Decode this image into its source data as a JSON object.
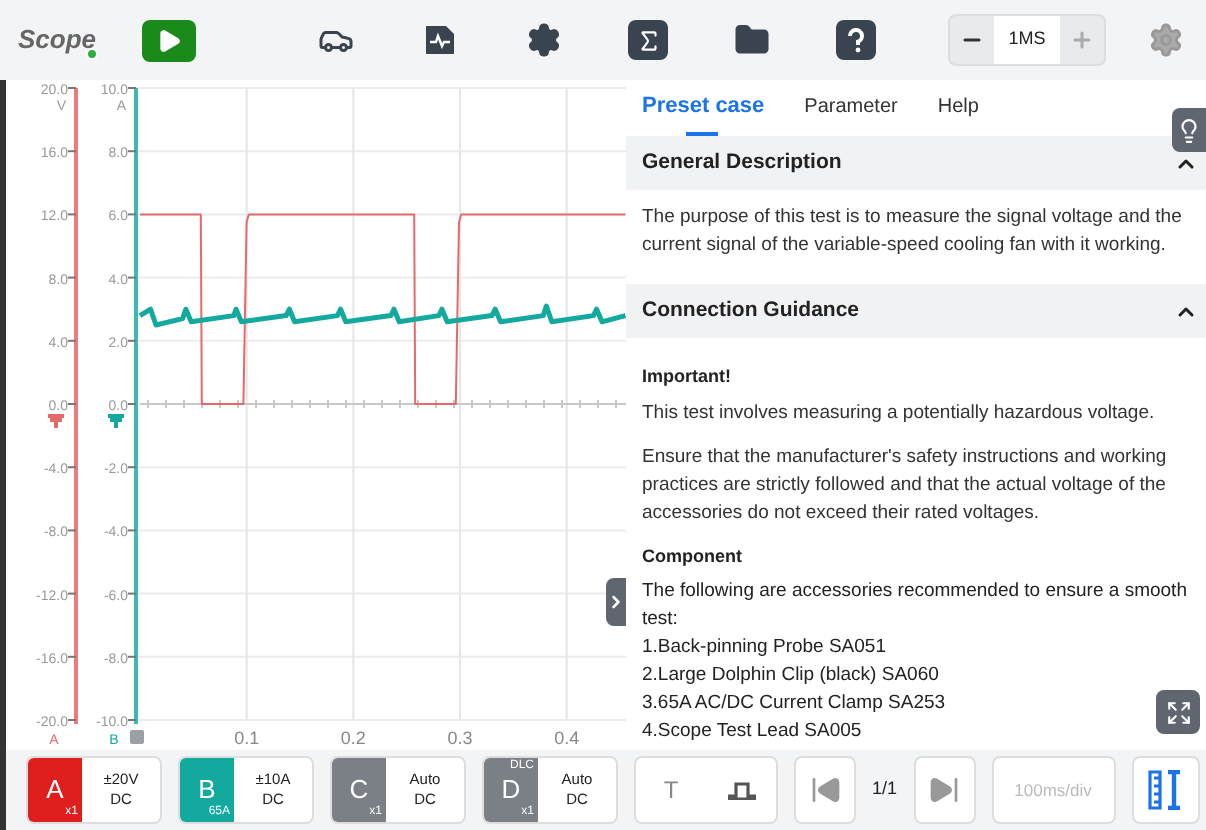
{
  "toolbar": {
    "logo": "Scope",
    "timebase": "1MS"
  },
  "chart": {
    "unit_a": "V",
    "unit_b": "A",
    "chart_data": {
      "type": "line",
      "xlim": [
        0,
        0.455
      ],
      "ylim": [
        -20,
        20
      ],
      "y2lim": [
        -10,
        10
      ],
      "grid": true,
      "ref_lines": [
        {
          "axis": "y",
          "value": 0
        }
      ],
      "xticks": [
        {
          "value": 0.1,
          "label": "0.1"
        },
        {
          "value": 0.2,
          "label": "0.2"
        },
        {
          "value": 0.3,
          "label": "0.3"
        },
        {
          "value": 0.4,
          "label": "0.4"
        }
      ],
      "yticks": [
        {
          "value": 20,
          "label": "20.0"
        },
        {
          "value": 16,
          "label": "16.0"
        },
        {
          "value": 12,
          "label": "12.0"
        },
        {
          "value": 8,
          "label": "8.0"
        },
        {
          "value": 4,
          "label": "4.0"
        },
        {
          "value": 0,
          "label": "0.0"
        },
        {
          "value": -4,
          "label": "-4.0"
        },
        {
          "value": -8,
          "label": "-8.0"
        },
        {
          "value": -12,
          "label": "-12.0"
        },
        {
          "value": -16,
          "label": "-16.0"
        },
        {
          "value": -20,
          "label": "-20.0"
        }
      ],
      "y2ticks": [
        {
          "value": 10,
          "label": "10.0"
        },
        {
          "value": 8,
          "label": "8.0"
        },
        {
          "value": 6,
          "label": "6.0"
        },
        {
          "value": 4,
          "label": "4.0"
        },
        {
          "value": 2,
          "label": "2.0"
        },
        {
          "value": 0,
          "label": "0.0"
        },
        {
          "value": -2,
          "label": "-2.0"
        },
        {
          "value": -4,
          "label": "-4.0"
        },
        {
          "value": -6,
          "label": "-6.0"
        },
        {
          "value": -8,
          "label": "-8.0"
        },
        {
          "value": -10,
          "label": "-10.0"
        }
      ],
      "series": [
        {
          "name": "A",
          "color": "#e46a6a",
          "x": [
            0,
            0.057,
            0.058,
            0.097,
            0.1,
            0.102,
            0.257,
            0.258,
            0.296,
            0.299,
            0.301,
            0.455
          ],
          "values": [
            12,
            12,
            0,
            0,
            11.5,
            12,
            12,
            0,
            0,
            11.5,
            12,
            12
          ]
        },
        {
          "name": "B",
          "color": "#14a99f",
          "axis": "y2",
          "x": [
            0,
            0.01,
            0.015,
            0.04,
            0.043,
            0.048,
            0.088,
            0.09,
            0.095,
            0.137,
            0.14,
            0.145,
            0.185,
            0.188,
            0.193,
            0.235,
            0.238,
            0.243,
            0.28,
            0.283,
            0.288,
            0.33,
            0.333,
            0.338,
            0.378,
            0.381,
            0.386,
            0.425,
            0.428,
            0.433,
            0.455
          ],
          "values": [
            2.8,
            3.0,
            2.5,
            2.7,
            3.0,
            2.6,
            2.8,
            3.0,
            2.6,
            2.8,
            3.0,
            2.6,
            2.8,
            3.0,
            2.6,
            2.8,
            3.0,
            2.6,
            2.8,
            3.0,
            2.6,
            2.8,
            3.0,
            2.6,
            2.8,
            3.1,
            2.6,
            2.8,
            3.0,
            2.6,
            2.8
          ]
        }
      ]
    }
  },
  "panel": {
    "tabs": [
      {
        "label": "Preset case",
        "selected": true
      },
      {
        "label": "Parameter",
        "selected": false
      },
      {
        "label": "Help",
        "selected": false
      }
    ],
    "sections": [
      {
        "title": "General Description",
        "expanded": true,
        "content": [
          {
            "kind": "paragraph",
            "text": "The purpose of this test is to measure the signal voltage and the current signal of the variable-speed cooling fan with it working."
          }
        ]
      },
      {
        "title": "Connection Guidance",
        "expanded": true,
        "content": [
          {
            "kind": "heading",
            "text": "Important!"
          },
          {
            "kind": "paragraph",
            "text": "This test involves measuring a potentially hazardous voltage."
          },
          {
            "kind": "paragraph",
            "text": "Ensure that the manufacturer's safety instructions and working practices are strictly followed and that the actual voltage of the accessories do not exceed their rated voltages."
          },
          {
            "kind": "heading",
            "text": "Component"
          },
          {
            "kind": "line",
            "text": "The following are accessories recommended to ensure a smooth test:"
          },
          {
            "kind": "line",
            "text": "1.Back-pinning Probe SA051"
          },
          {
            "kind": "line",
            "text": "2.Large Dolphin Clip (black) SA060"
          },
          {
            "kind": "line",
            "text": "3.65A AC/DC Current Clamp SA253"
          },
          {
            "kind": "line",
            "text": "4.Scope Test Lead SA005"
          }
        ]
      }
    ]
  },
  "bottom_bar": {
    "channels": [
      {
        "letter": "A",
        "color": "#e01e1e",
        "bottom_tag": "x1",
        "range": "±20V",
        "coupling": "DC"
      },
      {
        "letter": "B",
        "color": "#14a99f",
        "bottom_tag": "65A",
        "range": "±10A",
        "coupling": "DC"
      },
      {
        "letter": "C",
        "color": "#7b7f86",
        "bottom_tag": "x1",
        "range": "Auto",
        "coupling": "DC"
      },
      {
        "letter": "D",
        "color": "#7b7f86",
        "top_tag": "DLC",
        "bottom_tag": "x1",
        "range": "Auto",
        "coupling": "DC"
      }
    ],
    "trigger_label": "T",
    "page": "1/1",
    "time_per_div": {
      "text": "100ms/div",
      "disabled": true
    }
  }
}
